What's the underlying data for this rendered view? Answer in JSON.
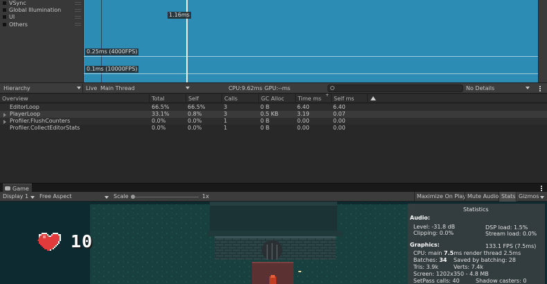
{
  "chart": {
    "legend": [
      {
        "label": "VSync"
      },
      {
        "label": "Global Illumination"
      },
      {
        "label": "UI"
      },
      {
        "label": "Others"
      }
    ],
    "selected_frame_label": "1.16ms",
    "guide_lines": [
      {
        "label": "0.25ms (4000FPS)"
      },
      {
        "label": "0.1ms (10000FPS)"
      }
    ],
    "graph_color": "#2c8cb3"
  },
  "profiler_toolbar": {
    "view_mode": "Hierarchy",
    "live_label": "Live",
    "thread": "Main Thread",
    "cpu": "CPU:9.62ms",
    "gpu": "GPU:--ms",
    "search_placeholder": "",
    "details": "No Details"
  },
  "table": {
    "columns": [
      "Overview",
      "Total",
      "Self",
      "Calls",
      "GC Alloc",
      "Time ms",
      "Self ms"
    ],
    "rows": [
      {
        "name": "EditorLoop",
        "total": "66.5%",
        "self": "66.5%",
        "calls": "3",
        "gc": "0 B",
        "time": "6.40",
        "self_ms": "6.40",
        "expandable": false
      },
      {
        "name": "PlayerLoop",
        "total": "33.1%",
        "self": "0.8%",
        "calls": "3",
        "gc": "0.5 KB",
        "time": "3.19",
        "self_ms": "0.07",
        "expandable": true
      },
      {
        "name": "Profiler.FlushCounters",
        "total": "0.0%",
        "self": "0.0%",
        "calls": "1",
        "gc": "0 B",
        "time": "0.00",
        "self_ms": "0.00",
        "expandable": true
      },
      {
        "name": "Profiler.CollectEditorStats",
        "total": "0.0%",
        "self": "0.0%",
        "calls": "1",
        "gc": "0 B",
        "time": "0.00",
        "self_ms": "0.00",
        "expandable": false
      }
    ]
  },
  "game": {
    "tab_label": "Game",
    "display": "Display 1",
    "aspect": "Free Aspect",
    "scale_label": "Scale",
    "scale_value": "1x",
    "buttons": [
      "Maximize On Play",
      "Mute Audio",
      "Stats",
      "Gizmos"
    ],
    "hud": {
      "score": "10"
    }
  },
  "stats": {
    "title": "Statistics",
    "audio_heading": "Audio:",
    "level": "Level: -31.8 dB",
    "clipping": "Clipping: 0.0%",
    "dsp_load": "DSP load: 1.5%",
    "stream_load": "Stream load: 0.0%",
    "fps": "133.1 FPS (7.5ms)",
    "graphics_heading": "Graphics:",
    "cpu_prefix": "CPU: main ",
    "cpu_main": "7.5",
    "cpu_suffix": "ms  render thread 2.5ms",
    "batches_prefix": "Batches: ",
    "batches": "34",
    "saved_batching": "Saved by batching: 28",
    "tris": "Tris: 3.9k",
    "verts": "Verts: 7.4k",
    "screen": "Screen: 1202x350 - 4.8 MB",
    "setpass": "SetPass calls: 40",
    "shadow_casters": "Shadow casters: 0"
  }
}
